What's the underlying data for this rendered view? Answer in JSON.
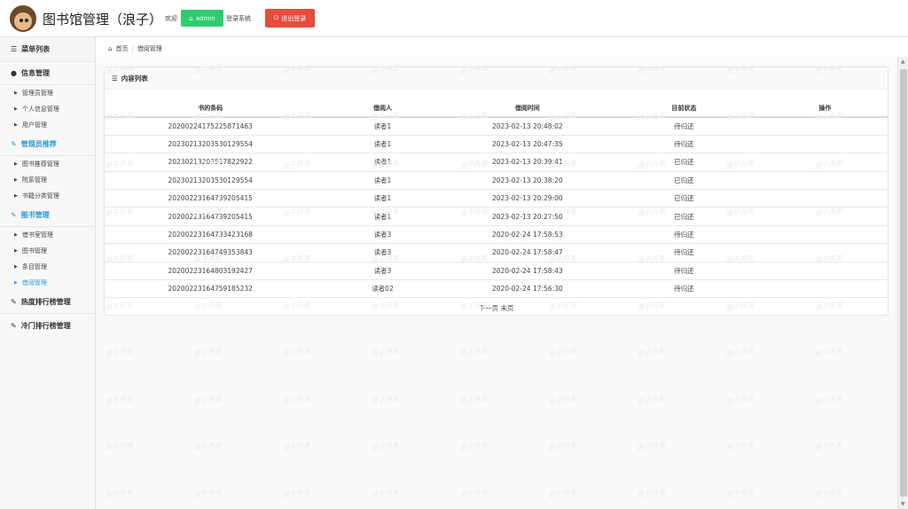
{
  "header": {
    "title": "图书馆管理（浪子）",
    "welcome": "欢迎",
    "user_btn": "admin",
    "login_text": "登录系统",
    "logout_btn": "退出登录"
  },
  "sidebar": {
    "menu_title": "菜单列表",
    "groups": [
      {
        "label": "信息管理",
        "items": [
          "管理员管理",
          "个人信息管理",
          "用户管理"
        ]
      },
      {
        "label": "管理员推荐",
        "items": [
          "图书推荐管理",
          "院系管理",
          "书籍分类管理"
        ]
      },
      {
        "label": "图书管理",
        "items": [
          "借书室管理",
          "图书管理",
          "条目管理",
          "借阅管理"
        ]
      },
      {
        "label": "热度排行榜管理",
        "items": []
      },
      {
        "label": "冷门排行榜管理",
        "items": []
      }
    ]
  },
  "breadcrumb": {
    "home": "首页",
    "current": "借阅管理"
  },
  "panel": {
    "title": "内容列表",
    "columns": [
      "书的条码",
      "借阅人",
      "借阅时间",
      "目前状态",
      "操作"
    ],
    "rows": [
      [
        "20200224175225871463",
        "读者1",
        "2023-02-13 20:48:02",
        "待归还",
        ""
      ],
      [
        "20230213203530129554",
        "读者1",
        "2023-02-13 20:47:35",
        "待归还",
        ""
      ],
      [
        "20230213203517822922",
        "读者1",
        "2023-02-13 20:39:41",
        "已归还",
        ""
      ],
      [
        "20230213203530129554",
        "读者1",
        "2023-02-13 20:38:20",
        "已归还",
        ""
      ],
      [
        "20200223164739205415",
        "读者1",
        "2023-02-13 20:29:00",
        "已归还",
        ""
      ],
      [
        "20200223164739205415",
        "读者1",
        "2023-02-13 20:27:50",
        "已归还",
        ""
      ],
      [
        "20200223164733423168",
        "读者3",
        "2020-02-24 17:58:53",
        "待归还",
        ""
      ],
      [
        "20200223164749353843",
        "读者3",
        "2020-02-24 17:58:47",
        "待归还",
        ""
      ],
      [
        "20200223164803192427",
        "读者3",
        "2020-02-24 17:58:43",
        "待归还",
        ""
      ],
      [
        "20200223164759185232",
        "读者02",
        "2020-02-24 17:56:30",
        "待归还",
        ""
      ]
    ],
    "pager": "下一页 末页"
  },
  "watermark": "浪子丹发",
  "colors": {
    "accent": "#2e9ad0",
    "success": "#2ecc71",
    "danger": "#e74c3c"
  }
}
